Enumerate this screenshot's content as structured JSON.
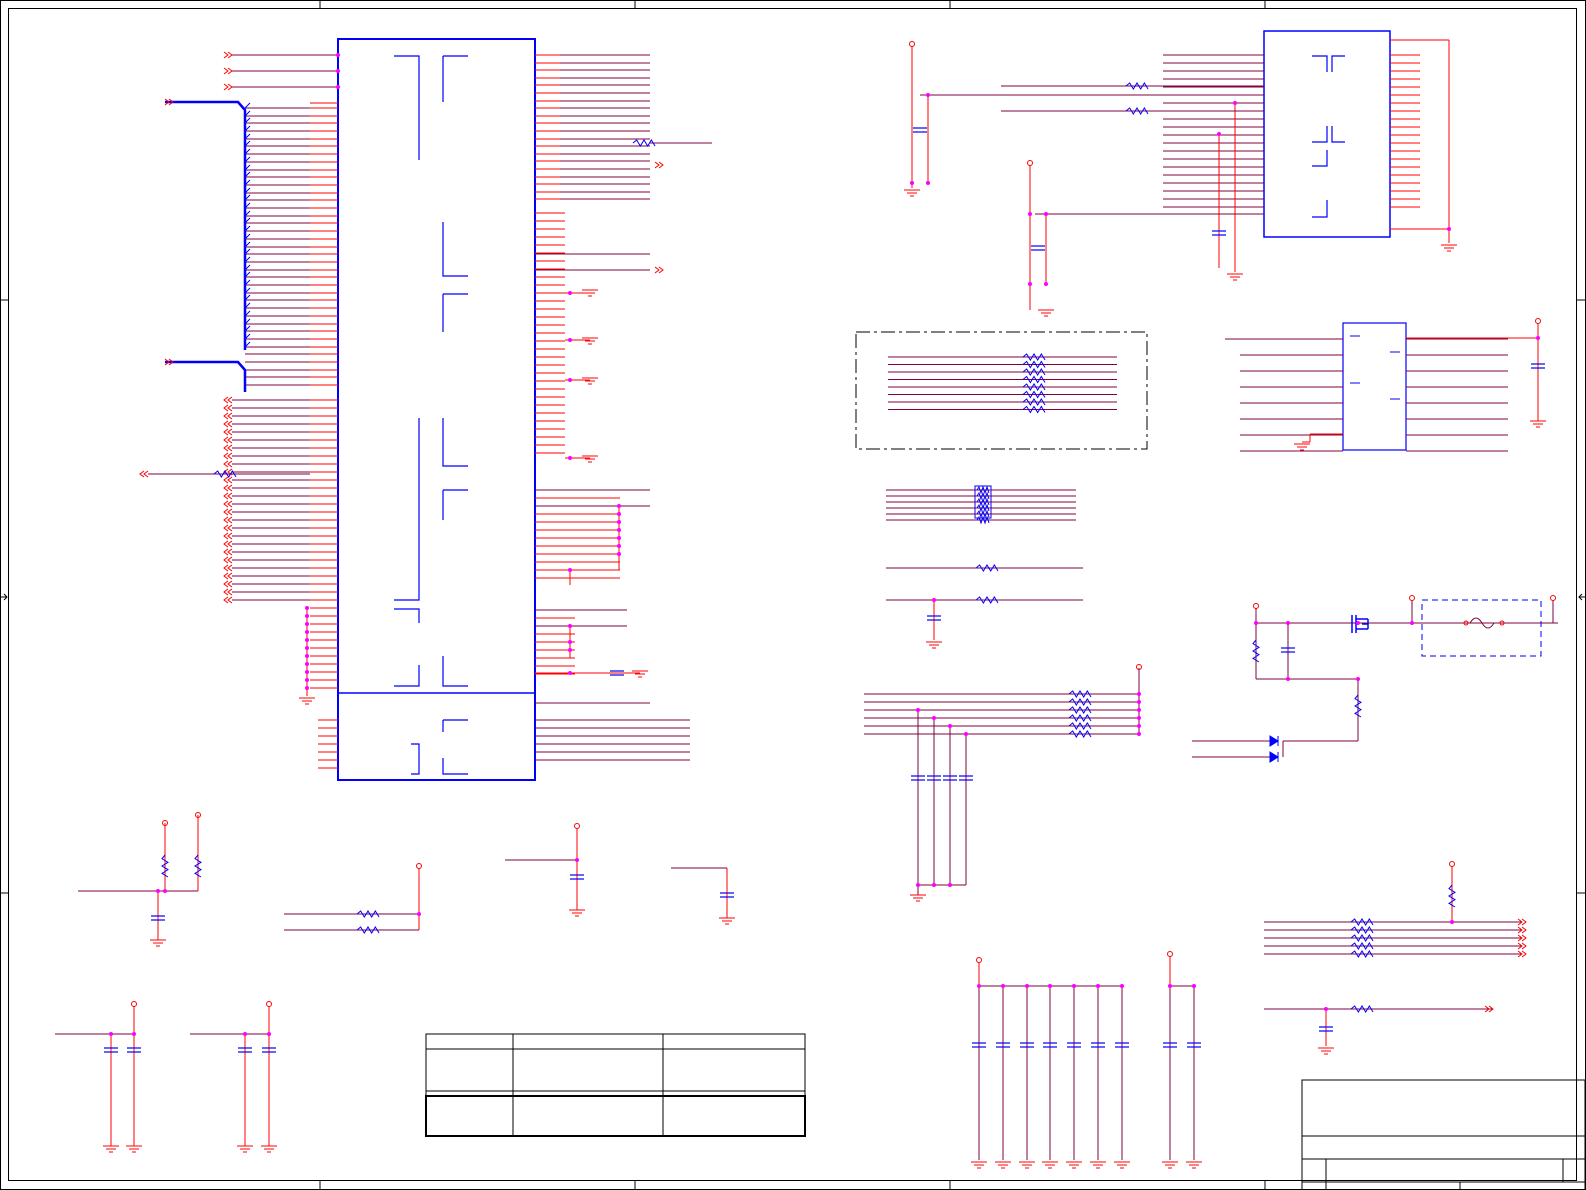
{
  "colors": {
    "background": "#ffffff",
    "frame": "#000000",
    "wire": "#ff0000",
    "net": "#800040",
    "part": "#0000ff",
    "junction": "#ff00ff",
    "bus": "#0000ff"
  },
  "sheet": {
    "visible_text": []
  },
  "main_ic": {
    "left_pin_count": 68,
    "right_pin_count": 60,
    "section_divider": true
  },
  "connectors": {
    "top_right_header": {
      "left_pins": 20,
      "right_pins": 20
    },
    "mid_right_ic": {
      "left_pins": 8,
      "right_pins": 8
    }
  },
  "resistor_networks": {
    "dashed_block_rows": 8,
    "small_array_rows": 6,
    "middle_array_rows": 6,
    "lower_right_array_rows": 5
  },
  "decoupling_caps": {
    "group_a": 7,
    "group_b": 2
  },
  "tables": {
    "revision_table": {
      "columns": 3,
      "rows": 3,
      "cells": []
    },
    "title_block": {
      "rows": 3,
      "cells": []
    }
  },
  "icons": {
    "ground": "ground-symbol-icon",
    "power": "power-pin-icon",
    "offpage": "offpage-connector-icon",
    "diode": "diode-icon",
    "mosfet": "mosfet-icon",
    "fuse": "fuse-icon"
  }
}
